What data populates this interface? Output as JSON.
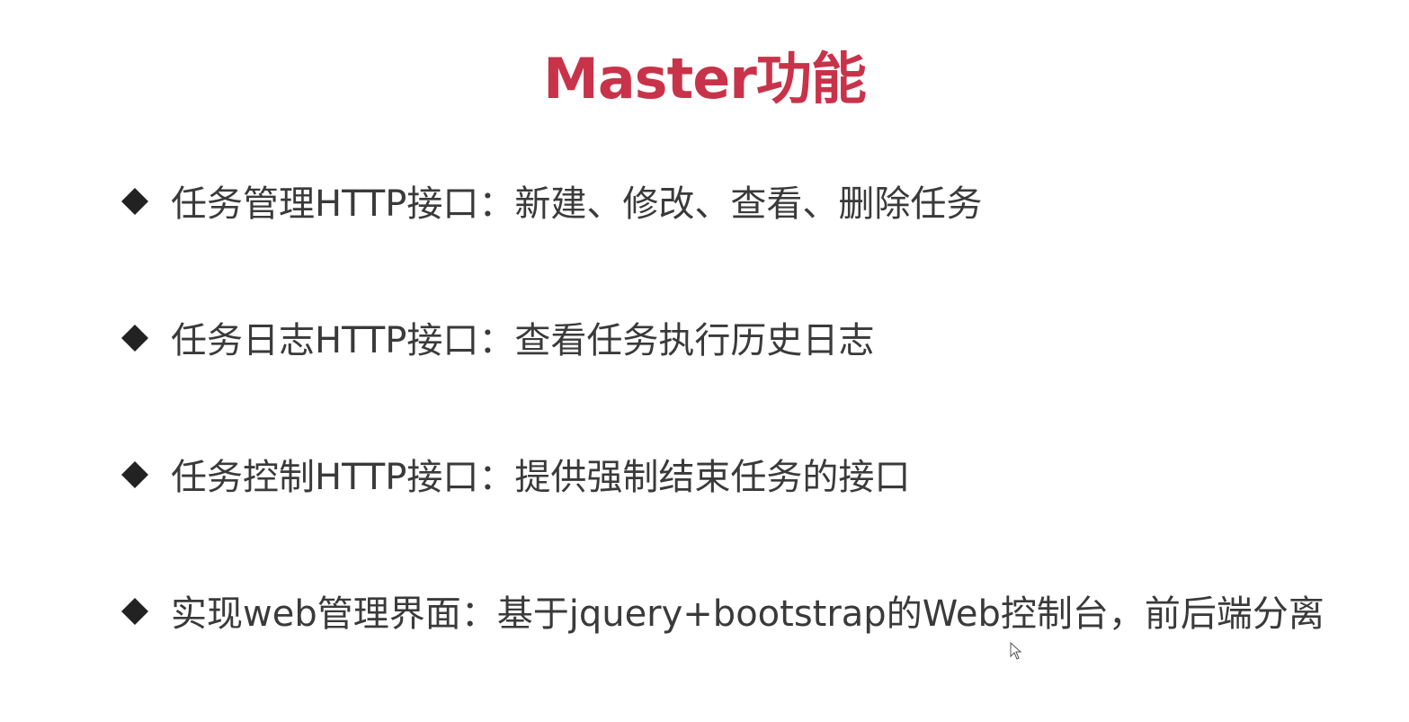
{
  "slide": {
    "title": "Master功能",
    "title_color": "#c8334a",
    "text_color": "#3a3a3a",
    "bullet_icon": "diamond-bullet",
    "bullets": [
      "任务管理HTTP接口：新建、修改、查看、删除任务",
      "任务日志HTTP接口：查看任务执行历史日志",
      "任务控制HTTP接口：提供强制结束任务的接口",
      "实现web管理界面：基于jquery+bootstrap的Web控制台，前后端分离"
    ]
  }
}
